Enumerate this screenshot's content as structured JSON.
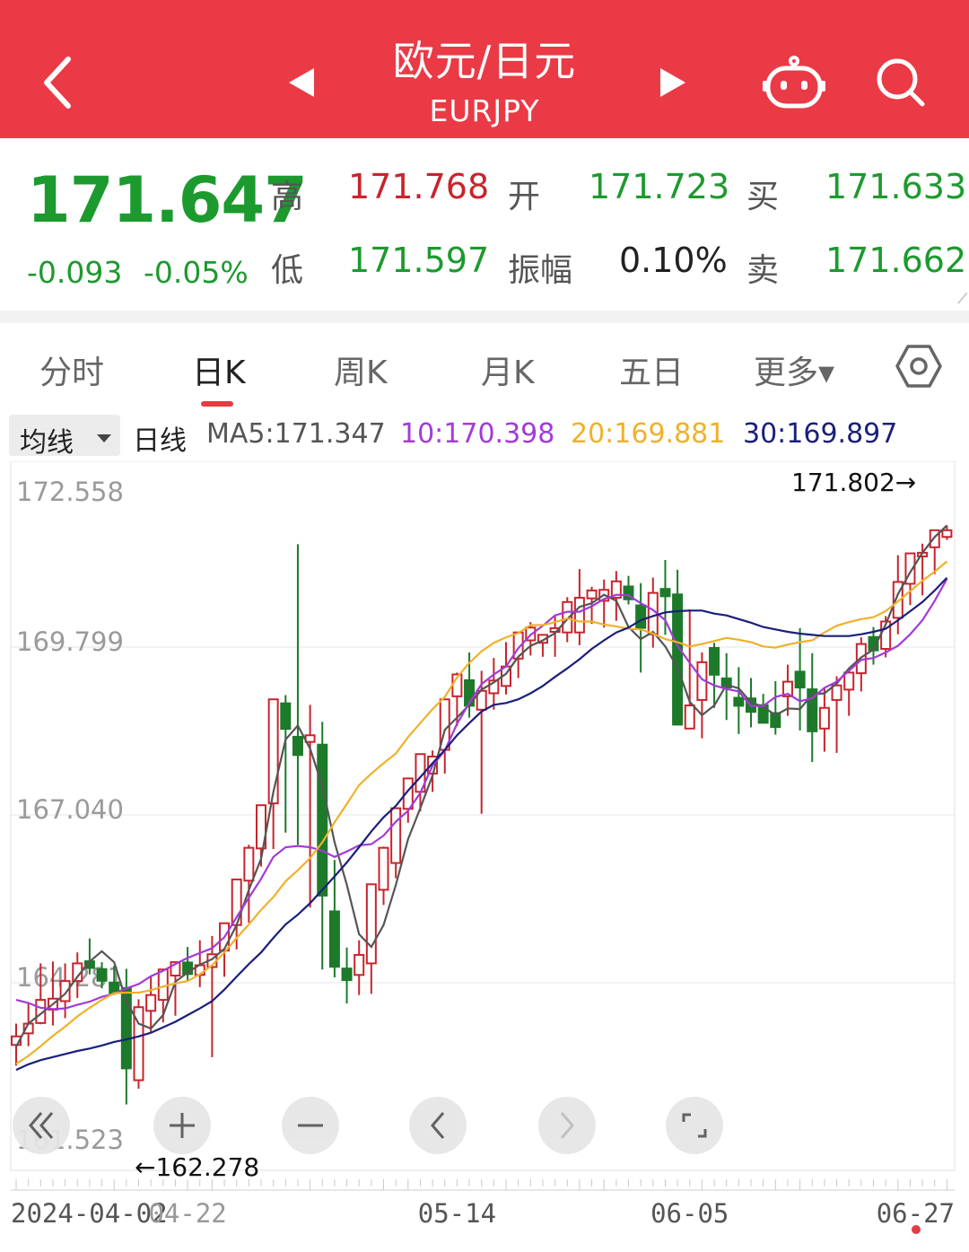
{
  "header": {
    "title": "欧元/日元",
    "subtitle": "EURJPY"
  },
  "quote": {
    "price": "171.647",
    "change": "-0.093",
    "change_pct": "-0.05%",
    "high_label": "高",
    "high": "171.768",
    "open_label": "开",
    "open": "171.723",
    "buy_label": "买",
    "buy": "171.633",
    "low_label": "低",
    "low": "171.597",
    "amplitude_label": "振幅",
    "amplitude": "0.10%",
    "sell_label": "卖",
    "sell": "171.662"
  },
  "tabs": [
    {
      "label": "分时"
    },
    {
      "label": "日K",
      "active": true
    },
    {
      "label": "周K"
    },
    {
      "label": "月K"
    },
    {
      "label": "五日"
    },
    {
      "label": "更多▾"
    }
  ],
  "indicator_bar": {
    "dropdown": "均线",
    "period": "日线",
    "ma5": "MA5:171.347",
    "ma10": "10:170.398",
    "ma20": "20:169.881",
    "ma30": "30:169.897"
  },
  "colors": {
    "header": "#ea3a45",
    "up": "#c8242c",
    "down": "#1c7a2a",
    "ma5": "#555555",
    "ma10": "#a33ad8",
    "ma20": "#f0b12a",
    "ma30": "#1a1f7a"
  },
  "icons": [
    "back-icon",
    "prev-arrow-icon",
    "next-arrow-icon",
    "robot-icon",
    "search-icon",
    "settings-icon",
    "collapse-icon",
    "zoom-in-icon",
    "zoom-out-icon",
    "pan-left-icon",
    "pan-right-icon",
    "fullscreen-icon"
  ],
  "chart_data": {
    "type": "candlestick",
    "y_ticks": [
      "172.558",
      "169.799",
      "167.040",
      "164.281",
      "161.523"
    ],
    "x_ticks": [
      "2024-04-02",
      "04-22",
      "05-14",
      "06-05",
      "06-27"
    ],
    "ylim": [
      161.523,
      172.558
    ],
    "max_label": "171.802→",
    "min_label": "←162.278",
    "grid": true,
    "candles": [
      [
        163.26,
        163.61,
        162.92,
        163.4
      ],
      [
        163.45,
        163.96,
        163.24,
        163.61
      ],
      [
        163.62,
        164.6,
        163.6,
        164.0
      ],
      [
        163.84,
        164.63,
        163.58,
        164.02
      ],
      [
        163.98,
        164.6,
        163.7,
        164.31
      ],
      [
        164.31,
        164.78,
        164.03,
        164.6
      ],
      [
        164.65,
        165.01,
        164.42,
        164.51
      ],
      [
        164.52,
        164.62,
        164.19,
        164.3
      ],
      [
        164.3,
        164.56,
        164.1,
        164.1
      ],
      [
        164.21,
        164.51,
        162.28,
        162.86
      ],
      [
        162.68,
        164.01,
        162.54,
        163.88
      ],
      [
        163.82,
        164.4,
        163.46,
        164.08
      ],
      [
        164.0,
        164.49,
        163.63,
        164.5
      ],
      [
        164.4,
        164.6,
        163.74,
        164.62
      ],
      [
        164.63,
        164.87,
        164.3,
        164.41
      ],
      [
        164.41,
        164.98,
        164.21,
        164.57
      ],
      [
        164.54,
        165.05,
        163.06,
        164.75
      ],
      [
        164.81,
        165.23,
        164.38,
        165.26
      ],
      [
        165.23,
        165.47,
        164.83,
        165.98
      ],
      [
        165.96,
        166.55,
        165.27,
        166.5
      ],
      [
        166.49,
        166.91,
        166.19,
        167.2
      ],
      [
        167.23,
        168.53,
        166.48,
        168.94
      ],
      [
        168.89,
        169.01,
        166.75,
        168.44
      ],
      [
        168.34,
        171.49,
        166.55,
        168.01
      ],
      [
        168.24,
        168.85,
        165.52,
        168.35
      ],
      [
        168.21,
        168.57,
        164.5,
        165.7
      ],
      [
        165.47,
        166.3,
        164.37,
        164.53
      ],
      [
        164.53,
        164.86,
        163.94,
        164.31
      ],
      [
        164.41,
        164.98,
        164.08,
        164.74
      ],
      [
        164.6,
        165.44,
        164.1,
        165.9
      ],
      [
        165.81,
        166.52,
        165.56,
        166.5
      ],
      [
        166.25,
        166.85,
        166.0,
        167.15
      ],
      [
        167.14,
        167.28,
        166.91,
        167.64
      ],
      [
        167.42,
        167.8,
        167.1,
        168.04
      ],
      [
        167.72,
        168.1,
        167.42,
        168.0
      ],
      [
        168.11,
        168.4,
        167.72,
        168.94
      ],
      [
        168.99,
        169.38,
        168.5,
        169.35
      ],
      [
        169.27,
        169.71,
        168.64,
        168.82
      ],
      [
        168.77,
        169.41,
        167.06,
        169.08
      ],
      [
        169.04,
        169.62,
        168.77,
        169.25
      ],
      [
        169.16,
        169.88,
        169.02,
        169.48
      ],
      [
        169.61,
        170.0,
        169.29,
        170.04
      ],
      [
        169.91,
        170.21,
        169.66,
        170.12
      ],
      [
        169.87,
        170.0,
        169.64,
        170.0
      ],
      [
        170.05,
        170.33,
        169.64,
        170.11
      ],
      [
        170.04,
        170.62,
        169.88,
        170.54
      ],
      [
        170.04,
        171.08,
        169.83,
        170.61
      ],
      [
        170.6,
        170.79,
        170.18,
        170.73
      ],
      [
        170.56,
        170.91,
        170.12,
        170.74
      ],
      [
        170.61,
        171.05,
        170.23,
        170.88
      ],
      [
        170.81,
        170.97,
        170.5,
        170.57
      ],
      [
        170.5,
        170.85,
        169.38,
        170.1
      ],
      [
        170.01,
        170.94,
        169.79,
        170.69
      ],
      [
        170.77,
        171.23,
        170.0,
        170.62
      ],
      [
        170.68,
        171.07,
        168.86,
        168.51
      ],
      [
        168.46,
        170.42,
        168.66,
        168.84
      ],
      [
        168.93,
        169.71,
        168.3,
        169.55
      ],
      [
        169.8,
        169.87,
        168.8,
        169.33
      ],
      [
        169.3,
        169.7,
        168.6,
        169.12
      ],
      [
        168.98,
        169.47,
        168.37,
        168.82
      ],
      [
        168.97,
        169.29,
        168.48,
        168.72
      ],
      [
        168.86,
        169.03,
        168.73,
        168.54
      ],
      [
        168.73,
        169.24,
        168.36,
        168.47
      ],
      [
        168.99,
        169.51,
        168.67,
        169.23
      ],
      [
        169.41,
        170.11,
        168.43,
        169.12
      ],
      [
        169.12,
        169.7,
        167.91,
        168.4
      ],
      [
        168.46,
        169.14,
        168.08,
        168.8
      ],
      [
        168.93,
        169.32,
        168.06,
        169.17
      ],
      [
        169.1,
        169.42,
        168.67,
        169.38
      ],
      [
        169.37,
        169.96,
        169.07,
        169.85
      ],
      [
        169.98,
        170.13,
        169.51,
        169.73
      ],
      [
        169.77,
        170.31,
        169.63,
        170.22
      ],
      [
        170.28,
        171.31,
        170.01,
        170.87
      ],
      [
        170.84,
        171.31,
        170.49,
        171.34
      ],
      [
        171.29,
        171.5,
        170.65,
        171.35
      ],
      [
        171.44,
        171.71,
        171.0,
        171.72
      ],
      [
        171.61,
        171.8,
        171.56,
        171.72
      ]
    ],
    "series": [
      {
        "name": "MA5",
        "values": [
          163.23,
          163.61,
          163.77,
          163.93,
          164.1,
          164.38,
          164.63,
          164.8,
          164.62,
          163.98,
          163.61,
          163.53,
          163.75,
          164.3,
          164.45,
          164.58,
          164.67,
          164.84,
          165.23,
          165.81,
          166.32,
          167.42,
          168.28,
          168.51,
          168.13,
          167.52,
          166.59,
          165.89,
          165.08,
          164.87,
          165.23,
          165.89,
          166.64,
          167.15,
          167.69,
          168.44,
          168.64,
          168.85,
          169.1,
          169.22,
          169.36,
          169.64,
          169.82,
          169.91,
          170.03,
          170.26,
          170.46,
          170.52,
          170.66,
          170.56,
          170.13,
          169.93,
          170.05,
          169.81,
          169.46,
          168.9,
          168.68,
          168.84,
          169.18,
          169.12,
          168.89,
          168.82,
          168.68,
          168.79,
          168.78,
          169.02,
          169.04,
          169.2,
          169.45,
          169.63,
          169.76,
          170.17,
          170.67,
          171.03,
          171.35,
          171.61,
          171.8
        ]
      },
      {
        "name": "10",
        "values": [
          164.0,
          163.95,
          163.87,
          163.85,
          163.86,
          163.92,
          163.97,
          164.05,
          164.1,
          164.19,
          164.26,
          164.39,
          164.48,
          164.59,
          164.69,
          164.77,
          164.85,
          165.03,
          165.36,
          165.68,
          165.99,
          166.35,
          166.51,
          166.53,
          166.51,
          166.45,
          166.35,
          166.44,
          166.54,
          166.56,
          166.7,
          166.93,
          167.11,
          167.4,
          167.85,
          168.1,
          168.54,
          168.88,
          169.19,
          169.35,
          169.48,
          169.78,
          170.0,
          170.15,
          170.32,
          170.38,
          170.38,
          170.47,
          170.59,
          170.66,
          170.65,
          170.52,
          170.41,
          170.24,
          169.82,
          169.54,
          169.27,
          169.17,
          169.11,
          169.07,
          168.83,
          168.83,
          168.98,
          169.03,
          168.91,
          168.96,
          169.13,
          169.23,
          169.41,
          169.59,
          169.62,
          169.71,
          169.82,
          170.01,
          170.24,
          170.56,
          170.92
        ]
      },
      {
        "name": "20",
        "values": [
          162.95,
          163.08,
          163.24,
          163.41,
          163.56,
          163.73,
          163.87,
          164.0,
          164.11,
          164.12,
          164.12,
          164.16,
          164.22,
          164.27,
          164.31,
          164.42,
          164.57,
          164.78,
          165.02,
          165.24,
          165.48,
          165.69,
          165.95,
          166.13,
          166.33,
          166.59,
          166.92,
          167.22,
          167.53,
          167.72,
          167.89,
          168.05,
          168.32,
          168.55,
          168.78,
          168.98,
          169.3,
          169.54,
          169.73,
          169.87,
          169.96,
          170.03,
          170.16,
          170.16,
          170.21,
          170.27,
          170.22,
          170.22,
          170.17,
          170.14,
          170.1,
          170.09,
          170.02,
          169.93,
          169.88,
          169.81,
          169.85,
          169.9,
          169.95,
          169.92,
          169.88,
          169.81,
          169.79,
          169.84,
          169.88,
          169.91,
          170.04,
          170.15,
          170.21,
          170.26,
          170.29,
          170.39,
          170.55,
          170.72,
          170.89,
          171.04,
          171.21
        ]
      },
      {
        "name": "30",
        "values": [
          162.85,
          162.94,
          163.01,
          163.06,
          163.11,
          163.16,
          163.2,
          163.25,
          163.31,
          163.35,
          163.4,
          163.46,
          163.55,
          163.64,
          163.75,
          163.86,
          163.98,
          164.17,
          164.38,
          164.59,
          164.78,
          165.02,
          165.24,
          165.4,
          165.59,
          165.81,
          166.03,
          166.26,
          166.51,
          166.77,
          167.0,
          167.19,
          167.44,
          167.66,
          167.89,
          168.11,
          168.35,
          168.55,
          168.74,
          168.85,
          168.88,
          168.94,
          169.04,
          169.16,
          169.31,
          169.45,
          169.6,
          169.77,
          169.91,
          170.04,
          170.12,
          170.24,
          170.31,
          170.37,
          170.39,
          170.4,
          170.4,
          170.35,
          170.32,
          170.26,
          170.2,
          170.13,
          170.09,
          170.05,
          170.02,
          170.0,
          169.98,
          169.98,
          169.98,
          170.01,
          170.05,
          170.1,
          170.24,
          170.39,
          170.54,
          170.73,
          170.94
        ]
      }
    ]
  }
}
